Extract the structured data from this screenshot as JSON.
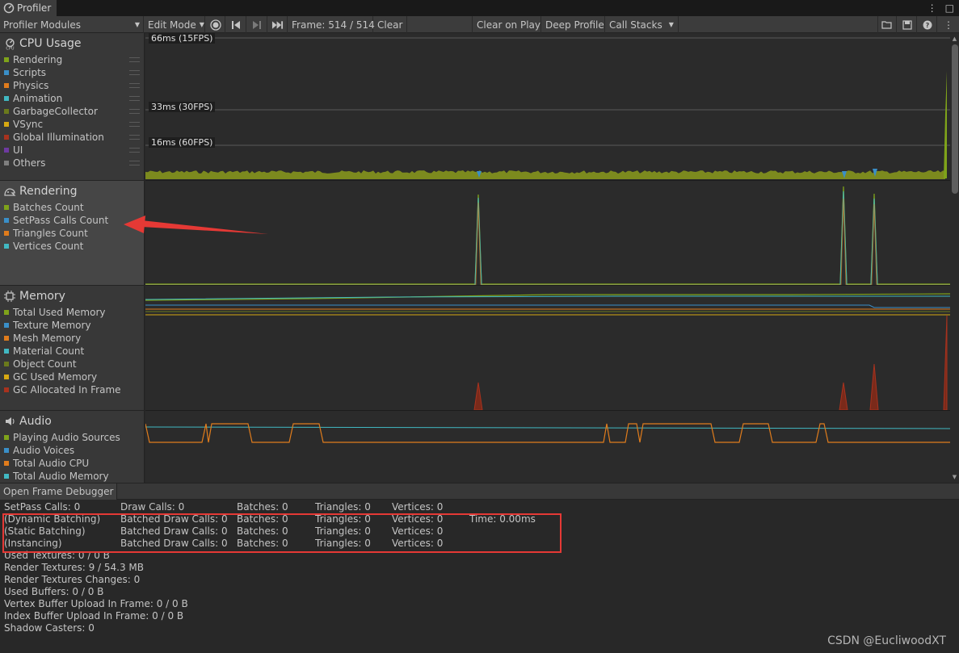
{
  "window": {
    "tab_title": "Profiler"
  },
  "toolbar": {
    "modules_label": "Profiler Modules",
    "edit_mode_label": "Edit Mode",
    "frame_label": "Frame: 514 / 514",
    "clear_label": "Clear",
    "clear_on_play_label": "Clear on Play",
    "deep_profile_label": "Deep Profile",
    "call_stacks_label": "Call Stacks"
  },
  "modules": {
    "cpu": {
      "title": "CPU Usage",
      "items": [
        {
          "label": "Rendering",
          "color": "#7fa31a"
        },
        {
          "label": "Scripts",
          "color": "#3a8fc8"
        },
        {
          "label": "Physics",
          "color": "#e07c1c"
        },
        {
          "label": "Animation",
          "color": "#41b8c2"
        },
        {
          "label": "GarbageCollector",
          "color": "#6b7a1c"
        },
        {
          "label": "VSync",
          "color": "#d7a812"
        },
        {
          "label": "Global Illumination",
          "color": "#a8321e"
        },
        {
          "label": "UI",
          "color": "#6e3aa0"
        },
        {
          "label": "Others",
          "color": "#7f7f7f"
        }
      ]
    },
    "rendering": {
      "title": "Rendering",
      "items": [
        {
          "label": "Batches Count",
          "color": "#7fa31a"
        },
        {
          "label": "SetPass Calls Count",
          "color": "#3a8fc8"
        },
        {
          "label": "Triangles Count",
          "color": "#e07c1c"
        },
        {
          "label": "Vertices Count",
          "color": "#41b8c2"
        }
      ]
    },
    "memory": {
      "title": "Memory",
      "items": [
        {
          "label": "Total Used Memory",
          "color": "#7fa31a"
        },
        {
          "label": "Texture Memory",
          "color": "#3a8fc8"
        },
        {
          "label": "Mesh Memory",
          "color": "#e07c1c"
        },
        {
          "label": "Material Count",
          "color": "#41b8c2"
        },
        {
          "label": "Object Count",
          "color": "#6b7a1c"
        },
        {
          "label": "GC Used Memory",
          "color": "#d7a812"
        },
        {
          "label": "GC Allocated In Frame",
          "color": "#a8321e"
        }
      ]
    },
    "audio": {
      "title": "Audio",
      "items": [
        {
          "label": "Playing Audio Sources",
          "color": "#7fa31a"
        },
        {
          "label": "Audio Voices",
          "color": "#3a8fc8"
        },
        {
          "label": "Total Audio CPU",
          "color": "#e07c1c"
        },
        {
          "label": "Total Audio Memory",
          "color": "#41b8c2"
        }
      ]
    }
  },
  "cpu_chart": {
    "labels": [
      "66ms (15FPS)",
      "33ms (30FPS)",
      "16ms (60FPS)"
    ]
  },
  "frame_debugger": {
    "button_label": "Open Frame Debugger"
  },
  "stats": {
    "row0": [
      "SetPass Calls: 0",
      "Draw Calls: 0",
      "Batches: 0",
      "Triangles: 0",
      "Vertices: 0"
    ],
    "row1": [
      "(Dynamic Batching)",
      "Batched Draw Calls: 0",
      "Batches: 0",
      "Triangles: 0",
      "Vertices: 0",
      "Time: 0.00ms"
    ],
    "row2": [
      "(Static Batching)",
      "Batched Draw Calls: 0",
      "Batches: 0",
      "Triangles: 0",
      "Vertices: 0"
    ],
    "row3": [
      "(Instancing)",
      "Batched Draw Calls: 0",
      "Batches: 0",
      "Triangles: 0",
      "Vertices: 0"
    ],
    "lines": [
      "Used Textures: 0 / 0 B",
      "Render Textures: 9 / 54.3 MB",
      "Render Textures Changes: 0",
      "Used Buffers: 0 / 0 B",
      "Vertex Buffer Upload In Frame: 0 / 0 B",
      "Index Buffer Upload In Frame: 0 / 0 B",
      "Shadow Casters: 0"
    ]
  },
  "watermark": "CSDN @EucliwoodXT"
}
